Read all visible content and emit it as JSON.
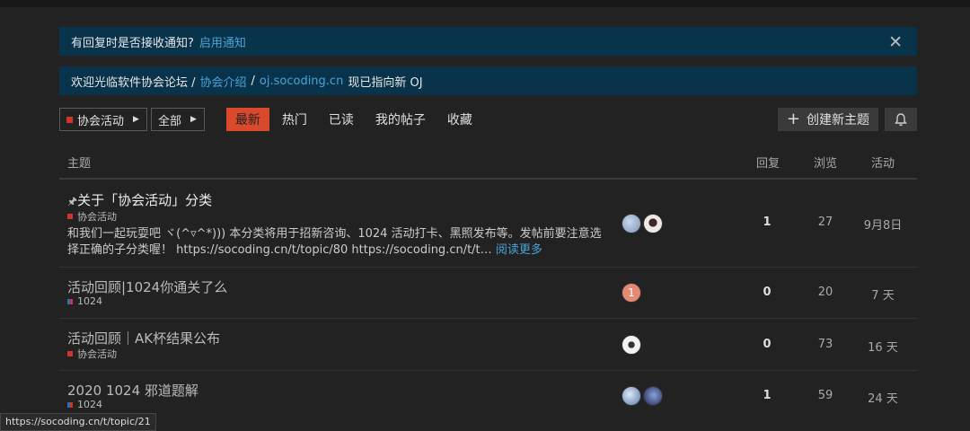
{
  "notify_banner": {
    "text": "有回复时是否接收通知?",
    "link": "启用通知",
    "close_glyph": "✕"
  },
  "welcome_banner": {
    "text1": "欢迎光临软件协会论坛 /",
    "link1": "协会介绍",
    "sep": "/",
    "link2": "oj.socoding.cn",
    "text2": "现已指向新 OJ"
  },
  "nav": {
    "category_dropdown": "协会活动",
    "subcategory_dropdown": "全部",
    "tabs": [
      "最新",
      "热门",
      "已读",
      "我的帖子",
      "收藏"
    ],
    "active_tab": "最新",
    "create_button": "创建新主题",
    "plus_icon": "+",
    "bell_icon": "bell-icon"
  },
  "table": {
    "headers": {
      "topic": "主题",
      "replies": "回复",
      "views": "浏览",
      "activity": "活动"
    },
    "rows": [
      {
        "pinned": true,
        "title": "关于「协会活动」分类",
        "category": "协会活动",
        "excerpt": "和我们一起玩耍吧 ヾ(^▿^*))) 本分类将用于招新咨询、1024 活动打卡、黑照发布等。发帖前要注意选择正确的子分类喔！ https://socoding.cn/t/topic/80 https://socoding.cn/t/t…",
        "read_more": "阅读更多",
        "replies": "1",
        "views": "27",
        "activity": "9月8日"
      },
      {
        "title": "活动回顾|1024你通关了么",
        "category": "1024",
        "avatar_letter": "1",
        "replies": "0",
        "views": "20",
        "activity": "7 天"
      },
      {
        "title": "活动回顾｜AK杯结果公布",
        "category": "协会活动",
        "replies": "0",
        "views": "73",
        "activity": "16 天"
      },
      {
        "title": "2020 1024 邪道题解",
        "category": "1024",
        "replies": "1",
        "views": "59",
        "activity": "24 天"
      }
    ]
  },
  "status_url": "https://socoding.cn/t/topic/21",
  "colors": {
    "background": "#222222",
    "banner": "#08334a",
    "accent": "#d9492c",
    "link": "#4aa3d8",
    "category_red": "#d0342c",
    "category_blue": "#2d6db5"
  }
}
